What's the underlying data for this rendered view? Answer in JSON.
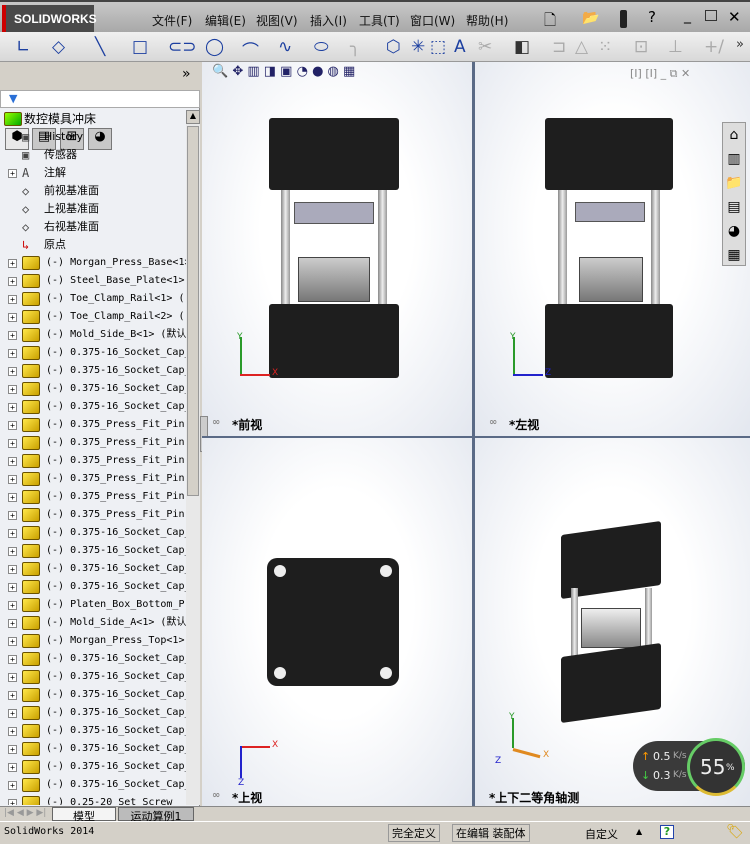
{
  "app": {
    "logo": "SOLIDWORKS",
    "menus": [
      "文件(F)",
      "编辑(E)",
      "视图(V)",
      "插入(I)",
      "工具(T)",
      "窗口(W)",
      "帮助(H)"
    ]
  },
  "panel": {
    "expand": "»",
    "filter": "▼"
  },
  "tree": {
    "root": "数控模具冲床",
    "fixed": [
      {
        "label": "History",
        "icon": "history-folder-icon",
        "plus": false
      },
      {
        "label": "传感器",
        "icon": "sensor-folder-icon",
        "plus": false
      },
      {
        "label": "注解",
        "icon": "annotation-folder-icon",
        "plus": true
      },
      {
        "label": "前视基准面",
        "icon": "plane-icon",
        "plus": false
      },
      {
        "label": "上视基准面",
        "icon": "plane-icon",
        "plus": false
      },
      {
        "label": "右视基准面",
        "icon": "plane-icon",
        "plus": false
      },
      {
        "label": "原点",
        "icon": "origin-icon",
        "plus": false
      }
    ],
    "parts": [
      "(-) Morgan_Press_Base<1>",
      "(-) Steel_Base_Plate<1>",
      "(-) Toe_Clamp_Rail<1> (",
      "(-) Toe_Clamp_Rail<2> (",
      "(-) Mold_Side_B<1> (默认",
      "(-) 0.375-16_Socket_Cap_",
      "(-) 0.375-16_Socket_Cap_",
      "(-) 0.375-16_Socket_Cap_",
      "(-) 0.375-16_Socket_Cap_",
      "(-) 0.375_Press_Fit_Pin",
      "(-) 0.375_Press_Fit_Pin",
      "(-) 0.375_Press_Fit_Pin",
      "(-) 0.375_Press_Fit_Pin",
      "(-) 0.375_Press_Fit_Pin",
      "(-) 0.375_Press_Fit_Pin",
      "(-) 0.375-16_Socket_Cap_",
      "(-) 0.375-16_Socket_Cap_",
      "(-) 0.375-16_Socket_Cap_",
      "(-) 0.375-16_Socket_Cap_",
      "(-) Platen_Box_Bottom_P",
      "(-) Mold_Side_A<1> (默认",
      "(-) Morgan_Press_Top<1>",
      "(-) 0.375-16_Socket_Cap_",
      "(-) 0.375-16_Socket_Cap_",
      "(-) 0.375-16_Socket_Cap_",
      "(-) 0.375-16_Socket_Cap_",
      "(-) 0.375-16_Socket_Cap_",
      "(-) 0.375-16_Socket_Cap_",
      "(-) 0.375-16_Socket_Cap_",
      "(-) 0.375-16_Socket_Cap_",
      "(-) 0.25-20_Set_Screw"
    ]
  },
  "viewports": {
    "front": "*前视",
    "left": "*左视",
    "top": "*上视",
    "iso": "*上下二等角轴测"
  },
  "axes": {
    "x": "X",
    "y": "Y",
    "z": "Z"
  },
  "bottom_tabs": [
    "模型",
    "运动算例1"
  ],
  "status": {
    "app": "SolidWorks 2014",
    "defined": "完全定义",
    "editing": "在编辑 装配体",
    "custom": "自定义",
    "help": "?"
  },
  "network": {
    "up": "0.5",
    "down": "0.3",
    "unit": "K/s",
    "percent": "55",
    "percent_sign": "%",
    "percent_value": 55
  }
}
